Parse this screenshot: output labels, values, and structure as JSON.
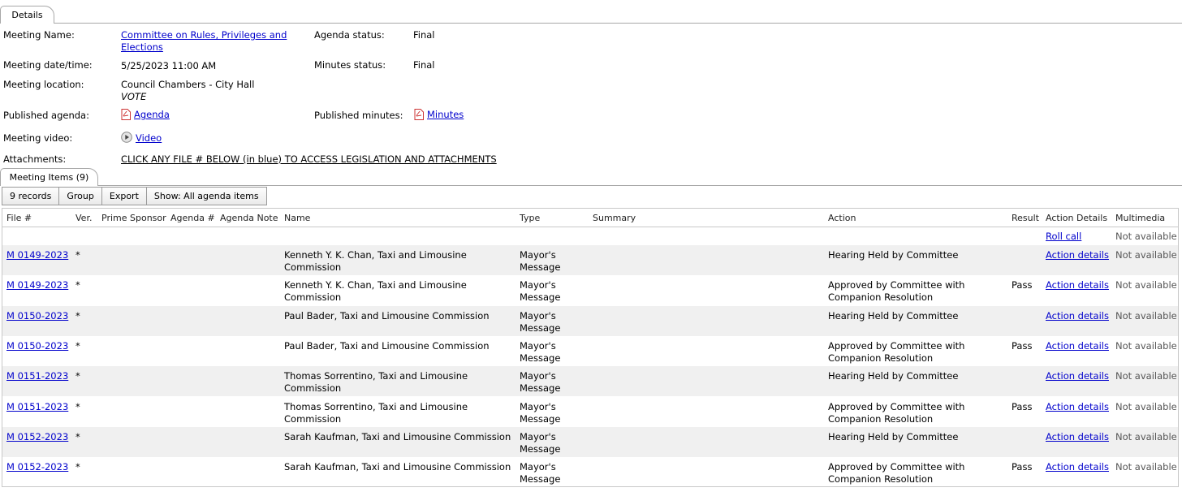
{
  "tabs": {
    "details": "Details",
    "meeting_items": "Meeting Items (9)"
  },
  "details": {
    "meeting_name_label": "Meeting Name:",
    "meeting_name_line1": "Committee on Rules, Privileges and",
    "meeting_name_line2": "Elections",
    "agenda_status_label": "Agenda status:",
    "agenda_status": "Final",
    "date_label": "Meeting date/time:",
    "date": "5/25/2023 11:00 AM",
    "minutes_status_label": "Minutes status:",
    "minutes_status": "Final",
    "location_label": "Meeting location:",
    "location_line1": "Council Chambers - City Hall",
    "location_line2": "VOTE",
    "published_agenda_label": "Published agenda:",
    "agenda_link": "Agenda",
    "published_minutes_label": "Published minutes:",
    "minutes_link": "Minutes",
    "video_label": "Meeting video:",
    "video_link": "Video",
    "attachments_label": "Attachments:",
    "attachments_link": "CLICK ANY FILE # BELOW (in blue) TO ACCESS LEGISLATION AND ATTACHMENTS"
  },
  "toolbar": {
    "records": "9 records",
    "group": "Group",
    "export": "Export",
    "show": "Show: All agenda items"
  },
  "table": {
    "headers": {
      "file": "File #",
      "ver": "Ver.",
      "prime": "Prime Sponsor",
      "agenda_num": "Agenda #",
      "agenda_note": "Agenda Note",
      "name": "Name",
      "type": "Type",
      "summary": "Summary",
      "action": "Action",
      "result": "Result",
      "action_details": "Action Details",
      "multimedia": "Multimedia"
    },
    "first_row": {
      "action_details": "Roll call",
      "multimedia": "Not available"
    },
    "rows": [
      {
        "file": "M 0149-2023",
        "ver": "*",
        "name1": "Kenneth Y. K. Chan, Taxi and Limousine",
        "name2": "Commission",
        "type1": "Mayor's",
        "type2": "Message",
        "action1": "Hearing Held by Committee",
        "action2": "",
        "result": "",
        "details": "Action details",
        "media": "Not available"
      },
      {
        "file": "M 0149-2023",
        "ver": "*",
        "name1": "Kenneth Y. K. Chan, Taxi and Limousine",
        "name2": "Commission",
        "type1": "Mayor's",
        "type2": "Message",
        "action1": "Approved by Committee with",
        "action2": "Companion Resolution",
        "result": "Pass",
        "details": "Action details",
        "media": "Not available"
      },
      {
        "file": "M 0150-2023",
        "ver": "*",
        "name1": "Paul Bader, Taxi and Limousine Commission",
        "name2": "",
        "type1": "Mayor's",
        "type2": "Message",
        "action1": "Hearing Held by Committee",
        "action2": "",
        "result": "",
        "details": "Action details",
        "media": "Not available"
      },
      {
        "file": "M 0150-2023",
        "ver": "*",
        "name1": "Paul Bader, Taxi and Limousine Commission",
        "name2": "",
        "type1": "Mayor's",
        "type2": "Message",
        "action1": "Approved by Committee with",
        "action2": "Companion Resolution",
        "result": "Pass",
        "details": "Action details",
        "media": "Not available"
      },
      {
        "file": "M 0151-2023",
        "ver": "*",
        "name1": "Thomas Sorrentino, Taxi and Limousine",
        "name2": "Commission",
        "type1": "Mayor's",
        "type2": "Message",
        "action1": "Hearing Held by Committee",
        "action2": "",
        "result": "",
        "details": "Action details",
        "media": "Not available"
      },
      {
        "file": "M 0151-2023",
        "ver": "*",
        "name1": "Thomas Sorrentino, Taxi and Limousine",
        "name2": "Commission",
        "type1": "Mayor's",
        "type2": "Message",
        "action1": "Approved by Committee with",
        "action2": "Companion Resolution",
        "result": "Pass",
        "details": "Action details",
        "media": "Not available"
      },
      {
        "file": "M 0152-2023",
        "ver": "*",
        "name1": "Sarah Kaufman, Taxi and Limousine Commission",
        "name2": "",
        "type1": "Mayor's",
        "type2": "Message",
        "action1": "Hearing Held by Committee",
        "action2": "",
        "result": "",
        "details": "Action details",
        "media": "Not available"
      },
      {
        "file": "M 0152-2023",
        "ver": "*",
        "name1": "Sarah Kaufman, Taxi and Limousine Commission",
        "name2": "",
        "type1": "Mayor's",
        "type2": "Message",
        "action1": "Approved by Committee with",
        "action2": "Companion Resolution",
        "result": "Pass",
        "details": "Action details",
        "media": "Not available"
      }
    ]
  }
}
